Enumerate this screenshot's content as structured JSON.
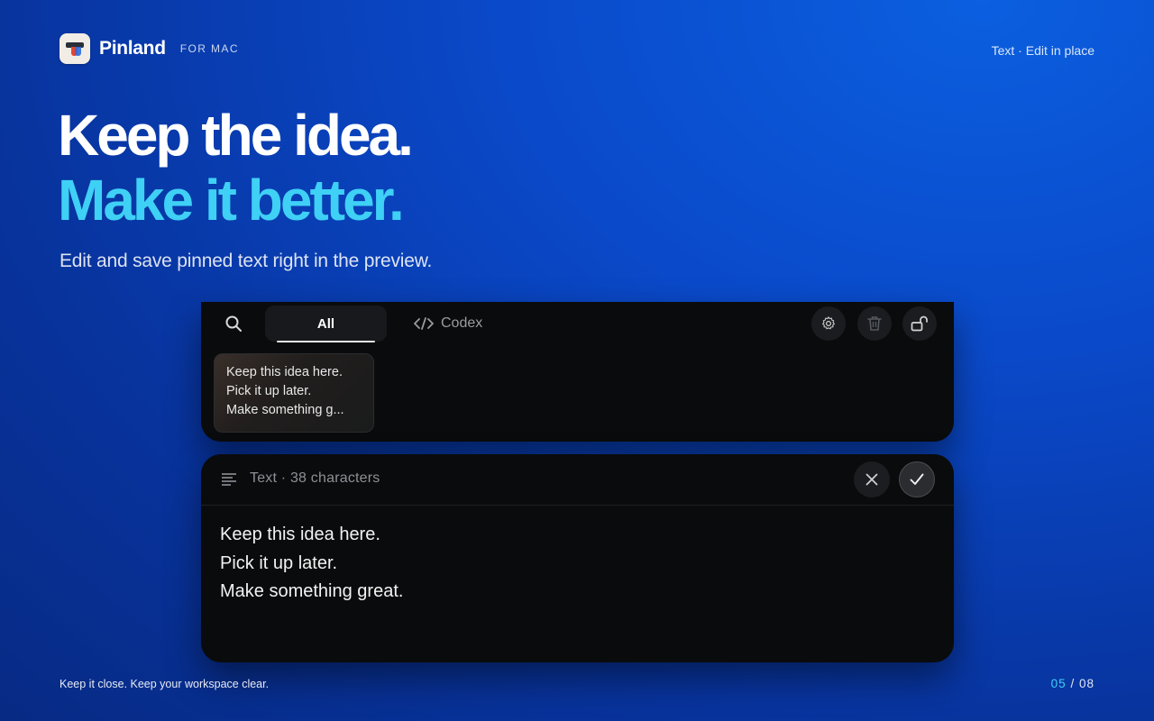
{
  "brand": {
    "name": "Pinland",
    "tag": "FOR MAC",
    "logo_icon": "pin-logo-icon"
  },
  "header": {
    "section": "Text · Edit in place"
  },
  "hero": {
    "line1": "Keep the idea.",
    "line2": "Make it better.",
    "subtitle": "Edit and save pinned text right in the preview."
  },
  "toolbar": {
    "search_icon": "search-icon",
    "tabs": [
      {
        "label": "All",
        "active": true
      },
      {
        "label": "Codex",
        "icon": "code-icon",
        "active": false
      }
    ],
    "actions": [
      "gear-icon",
      "trash-icon",
      "unlock-icon"
    ]
  },
  "pins": [
    {
      "lines": [
        "Keep this idea here.",
        "Pick it up later.",
        "Make something g..."
      ]
    }
  ],
  "editor": {
    "title": "Text · 38 characters",
    "cancel_icon": "close-icon",
    "confirm_icon": "check-icon",
    "content": [
      "Keep this idea here.",
      "Pick it up later.",
      "Make something great."
    ]
  },
  "footer": {
    "tagline": "Keep it close. Keep your workspace clear.",
    "page_current": "05",
    "page_sep": "/",
    "page_total": "08"
  },
  "colors": {
    "accent": "#3fd0f5",
    "panel": "#0a0b0c",
    "bg": "#0a49c9"
  }
}
